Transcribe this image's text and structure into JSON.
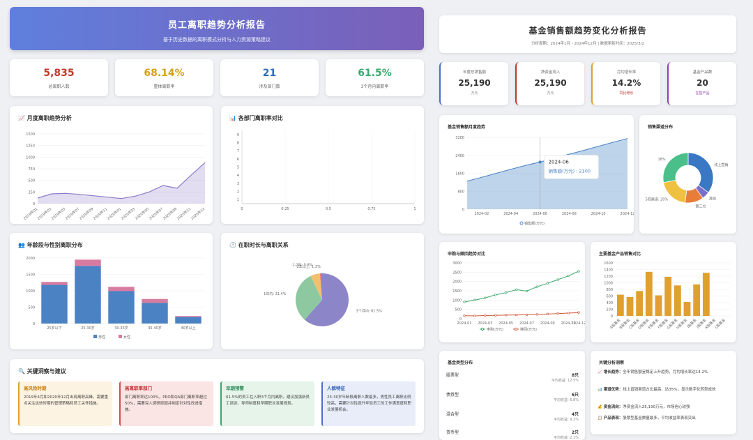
{
  "left": {
    "title": "员工离职趋势分析报告",
    "subtitle": "基于历史数据的离职模式分析与人力资源策略建议",
    "kpis": [
      {
        "value": "5,835",
        "label": "总离职人数",
        "color": "#c0392b"
      },
      {
        "value": "68.14%",
        "label": "整体离职率",
        "color": "#d4a017"
      },
      {
        "value": "21",
        "label": "涉及部门数",
        "color": "#2e6db4"
      },
      {
        "value": "61.5%",
        "label": "3个月内离职率",
        "color": "#3aa76d"
      }
    ],
    "monthly_title": "📈 月度离职趋势分析",
    "dept_title": "📊 各部门离职率对比",
    "age_title": "👥 年龄段与性别离职分布",
    "tenure_title": "🕐 在职时长与离职关系",
    "insights_title": "🔍 关键洞察与建议",
    "insights": [
      {
        "head": "高风险时期",
        "body": "2019年4月和2020年12月出现离职高峰，需要重点关注这些时期的管理策略和员工关怀措施。"
      },
      {
        "head": "高离职率部门",
        "body": "部门离职率达100%，PRO和QA部门离职率超过50%，需要深入调研原因并制定针对性改进措施。"
      },
      {
        "head": "早期预警",
        "body": "61.5%的员工在入职3个月内离职，建议加强新员工培训、导师制度和早期职业发展规划。"
      },
      {
        "head": "人群特征",
        "body": "25-30岁年龄段离职人数最多，男性员工离职比例较高，需要针对性提升年轻员工的工作满意度和职业发展机会。"
      }
    ]
  },
  "right": {
    "title": "基金销售额趋势变化分析报告",
    "subtitle": "分析周期：2024年1月 - 2024年12月 | 数据更新时间：2025/3/2",
    "kpis": [
      {
        "label": "年度总销售额",
        "value": "25,190",
        "unit": "万元",
        "color": "#4a6fc4",
        "unitColor": "#888"
      },
      {
        "label": "净资金流入",
        "value": "25,190",
        "unit": "万元",
        "color": "#c0392b",
        "unitColor": "#888"
      },
      {
        "label": "月均增长率",
        "value": "14.2%",
        "unit": "同比增长",
        "color": "#e0a030",
        "unitColor": "#c0392b"
      },
      {
        "label": "基金产品数",
        "value": "20",
        "unit": "在售产品",
        "color": "#8e44ad",
        "unitColor": "#8e44ad"
      }
    ],
    "trend_title": "基金销售额月度趋势",
    "channel_title": "销售渠道分布",
    "buyredeem_title": "申购与赎回趋势对比",
    "product_title": "主要基金产品销售对比",
    "types_title": "基金类型分布",
    "types": [
      {
        "name": "股票型",
        "count": "8只",
        "perf": "平均收益: 12.5%"
      },
      {
        "name": "债券型",
        "count": "6只",
        "perf": "平均收益: 6.8%"
      },
      {
        "name": "混合型",
        "count": "4只",
        "perf": "平均收益: 9.2%"
      },
      {
        "name": "货币型",
        "count": "2只",
        "perf": "平均收益: 2.1%"
      }
    ],
    "analysis_title": "关键分析洞察",
    "analysis": [
      {
        "head": "📈 增长趋势：",
        "body": "全年销售额呈稳定上升趋势，月均增长率达14.2%"
      },
      {
        "head": "📊 渠道优势：",
        "body": "线上直销渠道占比最高，达35%，显示数字化转型成效"
      },
      {
        "head": "💰 资金流向：",
        "body": "净资金流入25,190万元，市场信心较强"
      },
      {
        "head": "📋 产品表现：",
        "body": "股票型基金数量最多，平均收益率表现突出"
      }
    ]
  },
  "chart_data": [
    {
      "type": "area",
      "title": "📈 月度离职趋势分析",
      "x": [
        "2019年01",
        "2019年03",
        "2019年05",
        "2019年07",
        "2019年09",
        "2019年11",
        "2020年01",
        "2020年03",
        "2020年05",
        "2020年07",
        "2020年09",
        "2020年11",
        "2020年12"
      ],
      "values": [
        120,
        210,
        220,
        200,
        170,
        140,
        110,
        160,
        250,
        390,
        330,
        610,
        880
      ],
      "ylim": [
        0,
        1000
      ],
      "yticks": [
        0,
        250,
        500,
        750,
        1000,
        1250,
        1500
      ]
    },
    {
      "type": "bar",
      "title": "📊 各部门离职率对比",
      "xticks": [
        "0",
        "0.25",
        "0.5",
        "0.75",
        "1"
      ],
      "yticks": [
        "1",
        "2",
        "3",
        "4",
        "5",
        "6",
        "7",
        "8",
        "9"
      ]
    },
    {
      "type": "bar",
      "title": "👥 年龄段与性别离职分布",
      "categories": [
        "25岁以下",
        "25-30岁",
        "30-35岁",
        "35-40岁",
        "40岁以上"
      ],
      "series": [
        {
          "name": "男性",
          "values": [
            1180,
            1760,
            990,
            630,
            200
          ],
          "color": "#4a82c4"
        },
        {
          "name": "女性",
          "values": [
            90,
            190,
            130,
            120,
            30
          ],
          "color": "#d77ba0"
        }
      ],
      "yticks": [
        0,
        500,
        1000,
        1500,
        2000
      ],
      "ylim": [
        0,
        2000
      ]
    },
    {
      "type": "pie",
      "title": "🕐 在职时长与离职关系",
      "slices": [
        {
          "label": "3个月内: 61.5%",
          "value": 61.5,
          "color": "#8c86c8"
        },
        {
          "label": "1年内: 31.4%",
          "value": 31.4,
          "color": "#8dc8a0"
        },
        {
          "label": "1-2年: 5.8%",
          "value": 5.8,
          "color": "#f0c070"
        },
        {
          "label": "2年以上: 1.3%",
          "value": 1.3,
          "color": "#e07070"
        }
      ]
    },
    {
      "type": "area",
      "title": "基金销售额月度趋势",
      "x": [
        "2024-01",
        "2024-02",
        "2024-03",
        "2024-04",
        "2024-05",
        "2024-06",
        "2024-07",
        "2024-08",
        "2024-09",
        "2024-10",
        "2024-11",
        "2024-12"
      ],
      "values": [
        1250,
        1420,
        1600,
        1780,
        1950,
        2100,
        2280,
        2450,
        2620,
        2800,
        2980,
        3150
      ],
      "ylim": [
        0,
        3200
      ],
      "yticks": [
        0,
        800,
        1600,
        2400,
        3200
      ],
      "xtick_labels": [
        "2024-02",
        "2024-04",
        "2024-06",
        "2024-08",
        "2024-10",
        "2024-12"
      ],
      "tooltip": {
        "title": "2024-06",
        "text": "销售额(万元) : 2100"
      },
      "legend": "销售额(万元)"
    },
    {
      "type": "pie",
      "title": "销售渠道分布",
      "slices": [
        {
          "label": "线上直销",
          "value": 35,
          "color": "#3a78c4"
        },
        {
          "label": "其他",
          "value": 5,
          "color": "#7a6fc8"
        },
        {
          "label": "第三方",
          "value": 12,
          "color": "#e87d3a"
        },
        {
          "label": "5商渠道: 20%",
          "value": 20,
          "color": "#f0c040"
        },
        {
          "label": "18%",
          "value": 28,
          "color": "#4bbf8a"
        }
      ]
    },
    {
      "type": "line",
      "title": "申购与赎回趋势对比",
      "x": [
        "2024-01",
        "2024-02",
        "2024-03",
        "2024-04",
        "2024-05",
        "2024-06",
        "2024-07",
        "2024-08",
        "2024-09",
        "2024-10",
        "2024-11",
        "2024-12"
      ],
      "series": [
        {
          "name": "申购(万元)",
          "values": [
            900,
            1000,
            1120,
            1280,
            1400,
            1560,
            1480,
            1720,
            1900,
            2100,
            2300,
            2550
          ],
          "color": "#3aa76d"
        },
        {
          "name": "赎回(万元)",
          "values": [
            160,
            150,
            170,
            180,
            190,
            200,
            210,
            230,
            250,
            270,
            300,
            330
          ],
          "color": "#d0583a"
        }
      ],
      "ylim": [
        0,
        3000
      ],
      "yticks": [
        0,
        500,
        1000,
        1500,
        2000,
        2500,
        3000
      ],
      "xtick_labels": [
        "2024-01",
        "2024-03",
        "2024-05",
        "2024-07",
        "2024-09",
        "2024-11",
        "2024-12"
      ]
    },
    {
      "type": "bar",
      "title": "主要基金产品销售对比",
      "categories": [
        "A股基金",
        "B股基金",
        "C股基金",
        "D股基金",
        "E股基金",
        "F股基金",
        "G股基金",
        "H股基金",
        "I股基金",
        "J股基金",
        "K股基金",
        "L股基金"
      ],
      "values": [
        640,
        570,
        750,
        1330,
        620,
        1180,
        920,
        420,
        950,
        1300,
        0,
        0
      ],
      "ylim": [
        0,
        1600
      ],
      "yticks": [
        0,
        200,
        400,
        600,
        800,
        1000,
        1200,
        1400,
        1600
      ]
    }
  ]
}
